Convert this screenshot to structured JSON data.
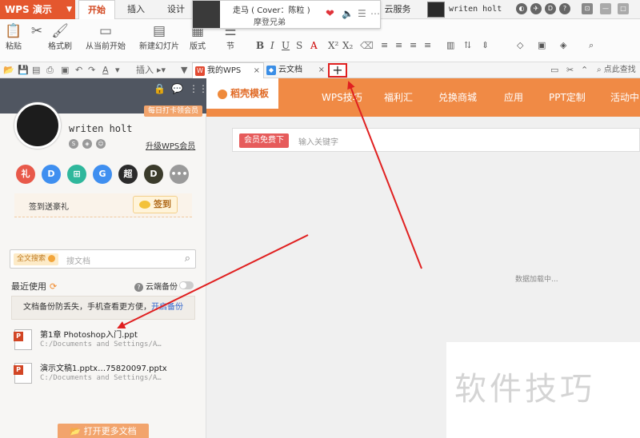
{
  "app": {
    "name": "WPS 演示",
    "menu_tabs": [
      "开始",
      "插入",
      "设计"
    ],
    "cloud_service": "云服务",
    "top_user": "writen holt"
  },
  "music": {
    "song": "走马 ( Cover：陈粒 )",
    "artist": "摩登兄弟"
  },
  "ribbon": {
    "paste": "粘贴",
    "format_painter": "格式刷",
    "from_current": "从当前开始",
    "new_slide": "新建幻灯片",
    "layout": "版式",
    "section": "节"
  },
  "quickbar": {
    "insert": "插入",
    "doc_tabs": [
      "我的WPS",
      "云文档"
    ],
    "new_tab": "+",
    "right_text": "点此查找"
  },
  "sidebar": {
    "checkin_badge": "每日打卡领会员",
    "username": "writen holt",
    "upgrade": "升级WPS会员",
    "icons": [
      {
        "glyph": "礼",
        "color": "#e8594a"
      },
      {
        "glyph": "D",
        "color": "#3f8ff0"
      },
      {
        "glyph": "⊞",
        "color": "#2fb79c"
      },
      {
        "glyph": "G",
        "color": "#3f8ff0"
      },
      {
        "glyph": "超",
        "color": "#2b2b2b"
      },
      {
        "glyph": "D",
        "color": "#3b3b2b"
      },
      {
        "glyph": "•••",
        "color": "#9a9a9a"
      }
    ],
    "sign_text": "签到送豪礼",
    "sign_button": "签到",
    "fulltext_search": "全文搜索",
    "search_placeholder": "搜文档",
    "recent_label": "最近使用",
    "cloud_backup_label": "云端备份",
    "notice_text": "文档备份防丢失，手机查看更方便，",
    "notice_link": "开启备份",
    "files": [
      {
        "name": "第1章 Photoshop入门.ppt",
        "path": "C:/Documents and Settings/A…"
      },
      {
        "name": "演示文稿1.pptx…75820097.pptx",
        "path": "C:/Documents and Settings/A…"
      }
    ],
    "open_more": "打开更多文档"
  },
  "main": {
    "nav_tabs": [
      "稻壳模板",
      "WPS技巧",
      "福利汇",
      "兑换商城",
      "应用",
      "PPT定制",
      "活动中"
    ],
    "member_free": "会员免费下",
    "keyword_placeholder": "输入关键字",
    "loading": "数据加载中...",
    "watermark": "软件技巧"
  },
  "colors": {
    "accent_orange": "#f08a45",
    "app_red": "#e4572e",
    "highlight_red": "#e02020"
  }
}
